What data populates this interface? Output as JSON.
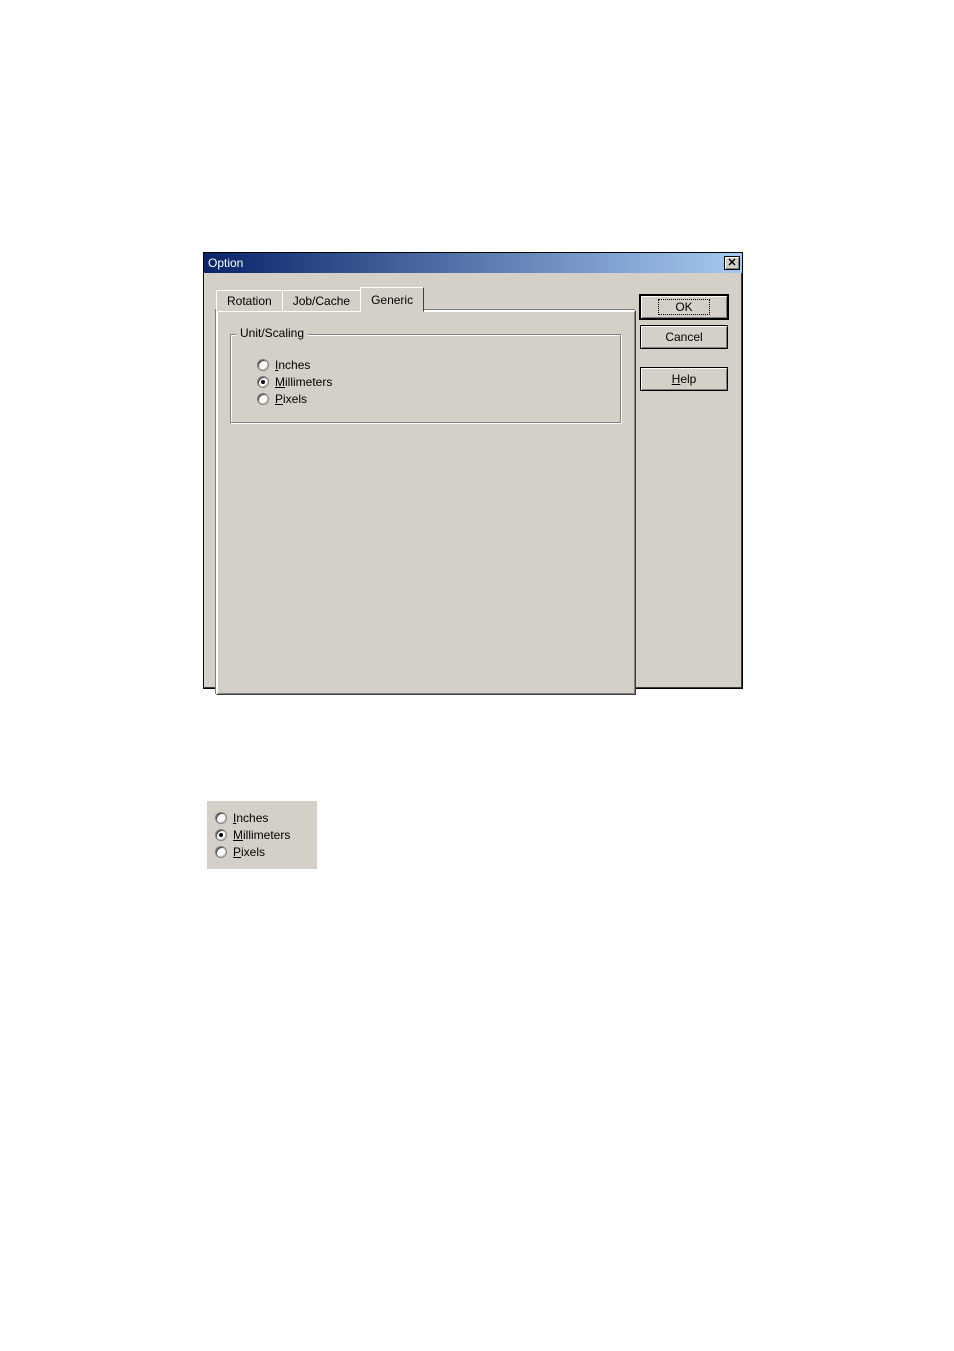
{
  "dialog": {
    "title": "Option",
    "tabs": [
      {
        "label": "Rotation",
        "active": false
      },
      {
        "label": "Job/Cache",
        "active": false
      },
      {
        "label": "Generic",
        "active": true
      }
    ],
    "groupbox": {
      "label": "Unit/Scaling",
      "options": [
        {
          "label": "Inches",
          "accel": "I",
          "selected": false
        },
        {
          "label": "Millimeters",
          "accel": "M",
          "selected": true
        },
        {
          "label": "Pixels",
          "accel": "P",
          "selected": false
        }
      ]
    },
    "buttons": {
      "ok": "OK",
      "cancel": "Cancel",
      "help": "Help",
      "help_accel": "H"
    }
  },
  "snippet": {
    "options": [
      {
        "label": "Inches",
        "accel": "I",
        "selected": false
      },
      {
        "label": "Millimeters",
        "accel": "M",
        "selected": true
      },
      {
        "label": "Pixels",
        "accel": "P",
        "selected": false
      }
    ]
  }
}
